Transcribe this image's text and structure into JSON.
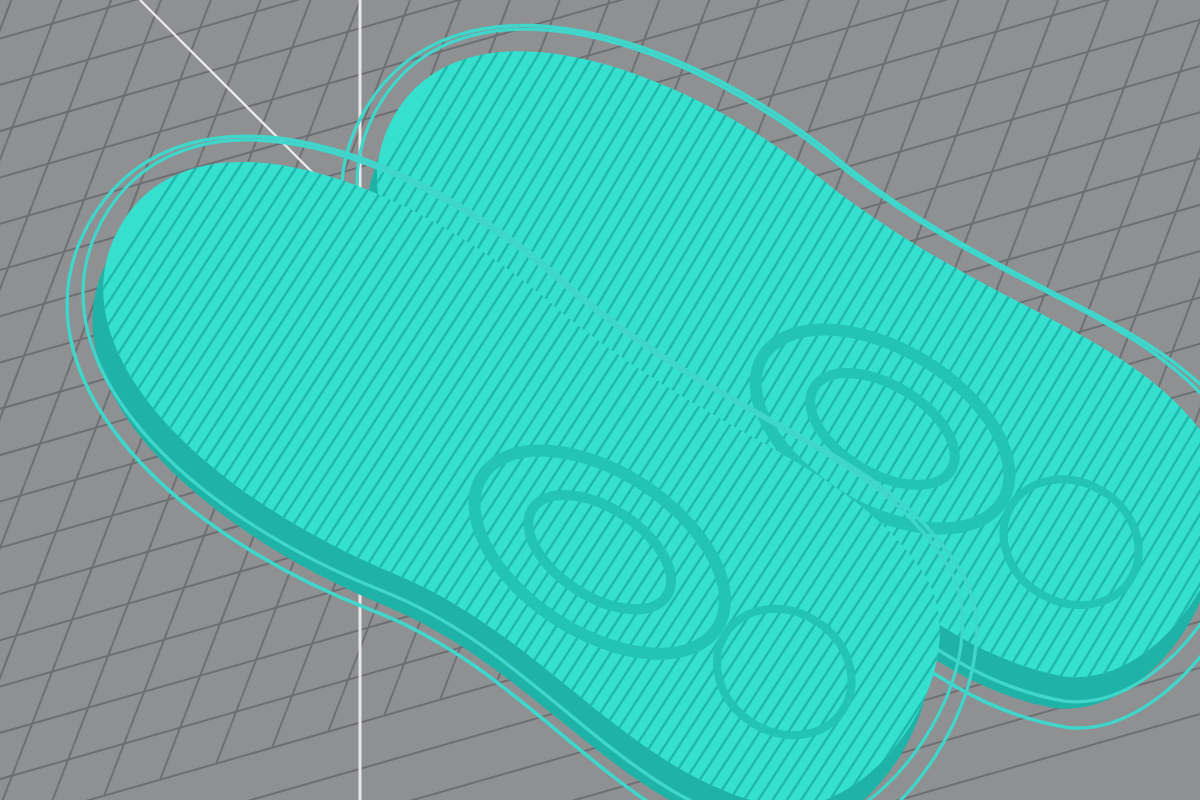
{
  "viewport": {
    "kind": "build-plate-3d"
  }
}
